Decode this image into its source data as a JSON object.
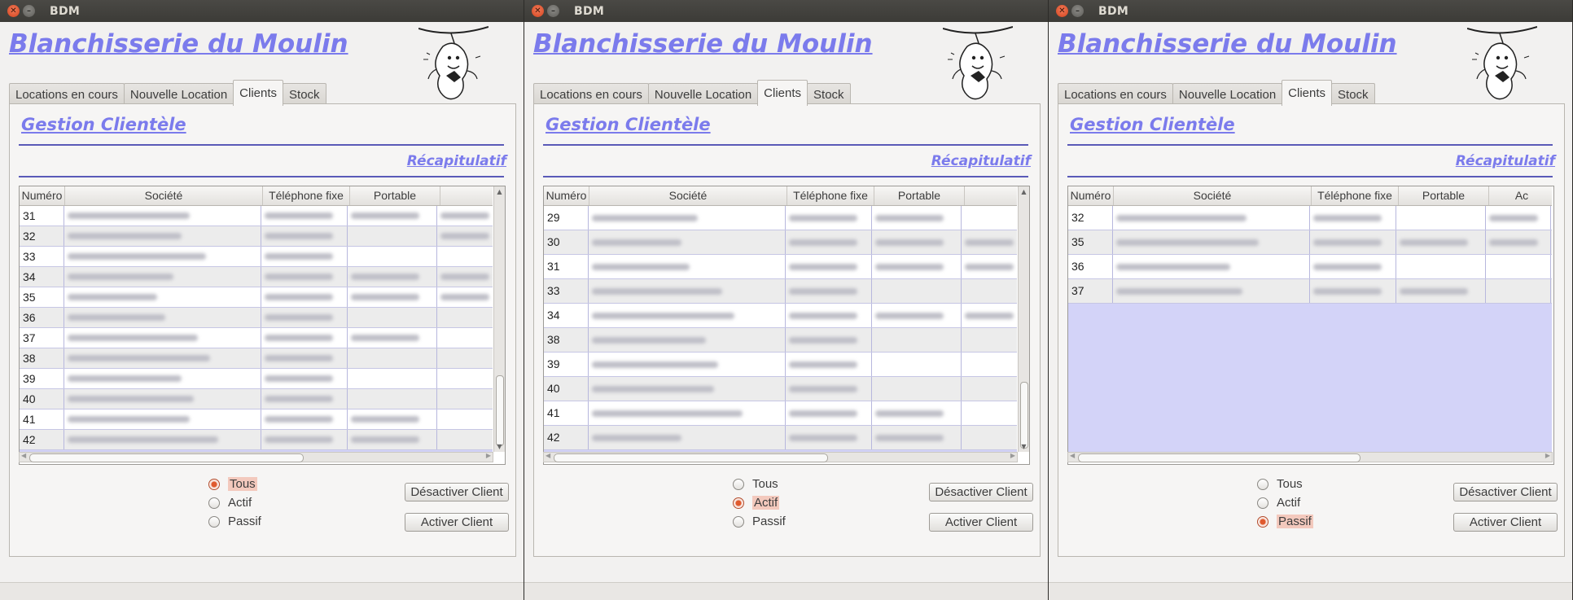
{
  "windows": [
    {
      "title": "BDM",
      "app_title": "Blanchisserie du Moulin",
      "tabs": [
        "Locations en cours",
        "Nouvelle Location",
        "Clients",
        "Stock"
      ],
      "active_tab": "Clients",
      "section_title": "Gestion Clientèle",
      "recap_label": "Récapitulatif",
      "columns": [
        "Numéro",
        "Société",
        "Téléphone fixe",
        "Portable",
        ""
      ],
      "rows": [
        {
          "num": "31",
          "has_portable": true,
          "has_extra": true
        },
        {
          "num": "32",
          "has_portable": false,
          "has_extra": true
        },
        {
          "num": "33",
          "has_portable": false,
          "has_extra": false
        },
        {
          "num": "34",
          "has_portable": true,
          "has_extra": true
        },
        {
          "num": "35",
          "has_portable": true,
          "has_extra": true
        },
        {
          "num": "36",
          "has_portable": false,
          "has_extra": false
        },
        {
          "num": "37",
          "has_portable": true,
          "has_extra": false
        },
        {
          "num": "38",
          "has_portable": false,
          "has_extra": false
        },
        {
          "num": "39",
          "has_portable": false,
          "has_extra": false
        },
        {
          "num": "40",
          "has_portable": false,
          "has_extra": false
        },
        {
          "num": "41",
          "has_portable": true,
          "has_extra": false
        },
        {
          "num": "42",
          "has_portable": true,
          "has_extra": false
        }
      ],
      "filter_options": [
        "Tous",
        "Actif",
        "Passif"
      ],
      "selected_filter": "Tous",
      "deactivate_label": "Désactiver Client",
      "activate_label": "Activer Client",
      "close_icon": "close-icon",
      "minimize_icon": "minimize-icon"
    },
    {
      "title": "BDM",
      "app_title": "Blanchisserie du Moulin",
      "tabs": [
        "Locations en cours",
        "Nouvelle Location",
        "Clients",
        "Stock"
      ],
      "active_tab": "Clients",
      "section_title": "Gestion Clientèle",
      "recap_label": "Récapitulatif",
      "columns": [
        "Numéro",
        "Société",
        "Téléphone fixe",
        "Portable",
        ""
      ],
      "rows": [
        {
          "num": "29",
          "has_portable": true,
          "has_extra": false
        },
        {
          "num": "30",
          "has_portable": true,
          "has_extra": true
        },
        {
          "num": "31",
          "has_portable": true,
          "has_extra": true
        },
        {
          "num": "33",
          "has_portable": false,
          "has_extra": false
        },
        {
          "num": "34",
          "has_portable": true,
          "has_extra": true
        },
        {
          "num": "38",
          "has_portable": false,
          "has_extra": false
        },
        {
          "num": "39",
          "has_portable": false,
          "has_extra": false
        },
        {
          "num": "40",
          "has_portable": false,
          "has_extra": false
        },
        {
          "num": "41",
          "has_portable": true,
          "has_extra": false
        },
        {
          "num": "42",
          "has_portable": true,
          "has_extra": false
        }
      ],
      "filter_options": [
        "Tous",
        "Actif",
        "Passif"
      ],
      "selected_filter": "Actif",
      "deactivate_label": "Désactiver Client",
      "activate_label": "Activer Client",
      "close_icon": "close-icon",
      "minimize_icon": "minimize-icon"
    },
    {
      "title": "BDM",
      "app_title": "Blanchisserie du Moulin",
      "tabs": [
        "Locations en cours",
        "Nouvelle Location",
        "Clients",
        "Stock"
      ],
      "active_tab": "Clients",
      "section_title": "Gestion Clientèle",
      "recap_label": "Récapitulatif",
      "columns": [
        "Numéro",
        "Société",
        "Téléphone fixe",
        "Portable",
        "Ac"
      ],
      "rows": [
        {
          "num": "32",
          "has_portable": false,
          "has_extra": true
        },
        {
          "num": "35",
          "has_portable": true,
          "has_extra": true
        },
        {
          "num": "36",
          "has_portable": false,
          "has_extra": false
        },
        {
          "num": "37",
          "has_portable": true,
          "has_extra": false
        }
      ],
      "filter_options": [
        "Tous",
        "Actif",
        "Passif"
      ],
      "selected_filter": "Passif",
      "deactivate_label": "Désactiver Client",
      "activate_label": "Activer Client",
      "close_icon": "close-icon",
      "minimize_icon": "minimize-icon"
    }
  ]
}
